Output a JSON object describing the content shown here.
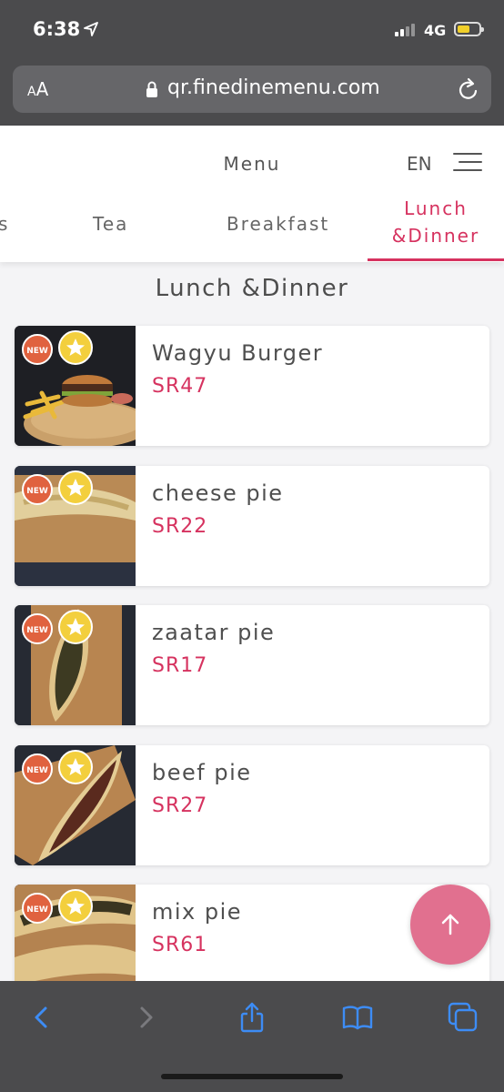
{
  "status_bar": {
    "time": "6:38",
    "network": "4G"
  },
  "browser": {
    "text_size_label": "AA",
    "url": "qr.finedinemenu.com"
  },
  "header": {
    "title": "Menu",
    "language": "EN",
    "tabs": [
      {
        "label": "s"
      },
      {
        "label": "Tea"
      },
      {
        "label": "Breakfast"
      },
      {
        "label": "Lunch\n&Dinner",
        "line1": "Lunch",
        "line2": "&Dinner",
        "active": true
      }
    ]
  },
  "section_title": "Lunch &Dinner",
  "items": [
    {
      "name": "Wagyu Burger",
      "price": "SR47",
      "badges": [
        "NEW",
        "star"
      ]
    },
    {
      "name": "cheese pie",
      "price": "SR22",
      "badges": [
        "NEW",
        "star"
      ]
    },
    {
      "name": "zaatar pie",
      "price": "SR17",
      "badges": [
        "NEW",
        "star"
      ]
    },
    {
      "name": "beef pie",
      "price": "SR27",
      "badges": [
        "NEW",
        "star"
      ]
    },
    {
      "name": "mix pie",
      "price": "SR61",
      "badges": [
        "NEW",
        "star"
      ]
    }
  ],
  "badge_new_label": "NEW",
  "colors": {
    "accent": "#d6325f",
    "fab": "#e1708f",
    "badge_new": "#e0623f",
    "badge_star": "#f3cf3d",
    "browser_chrome": "#4b4b4d"
  },
  "icons": [
    "location-arrow-icon",
    "lock-icon",
    "reload-icon",
    "hamburger-menu-icon",
    "arrow-up-icon",
    "back-chevron-icon",
    "forward-chevron-icon",
    "share-icon",
    "bookmarks-icon",
    "tabs-icon"
  ]
}
